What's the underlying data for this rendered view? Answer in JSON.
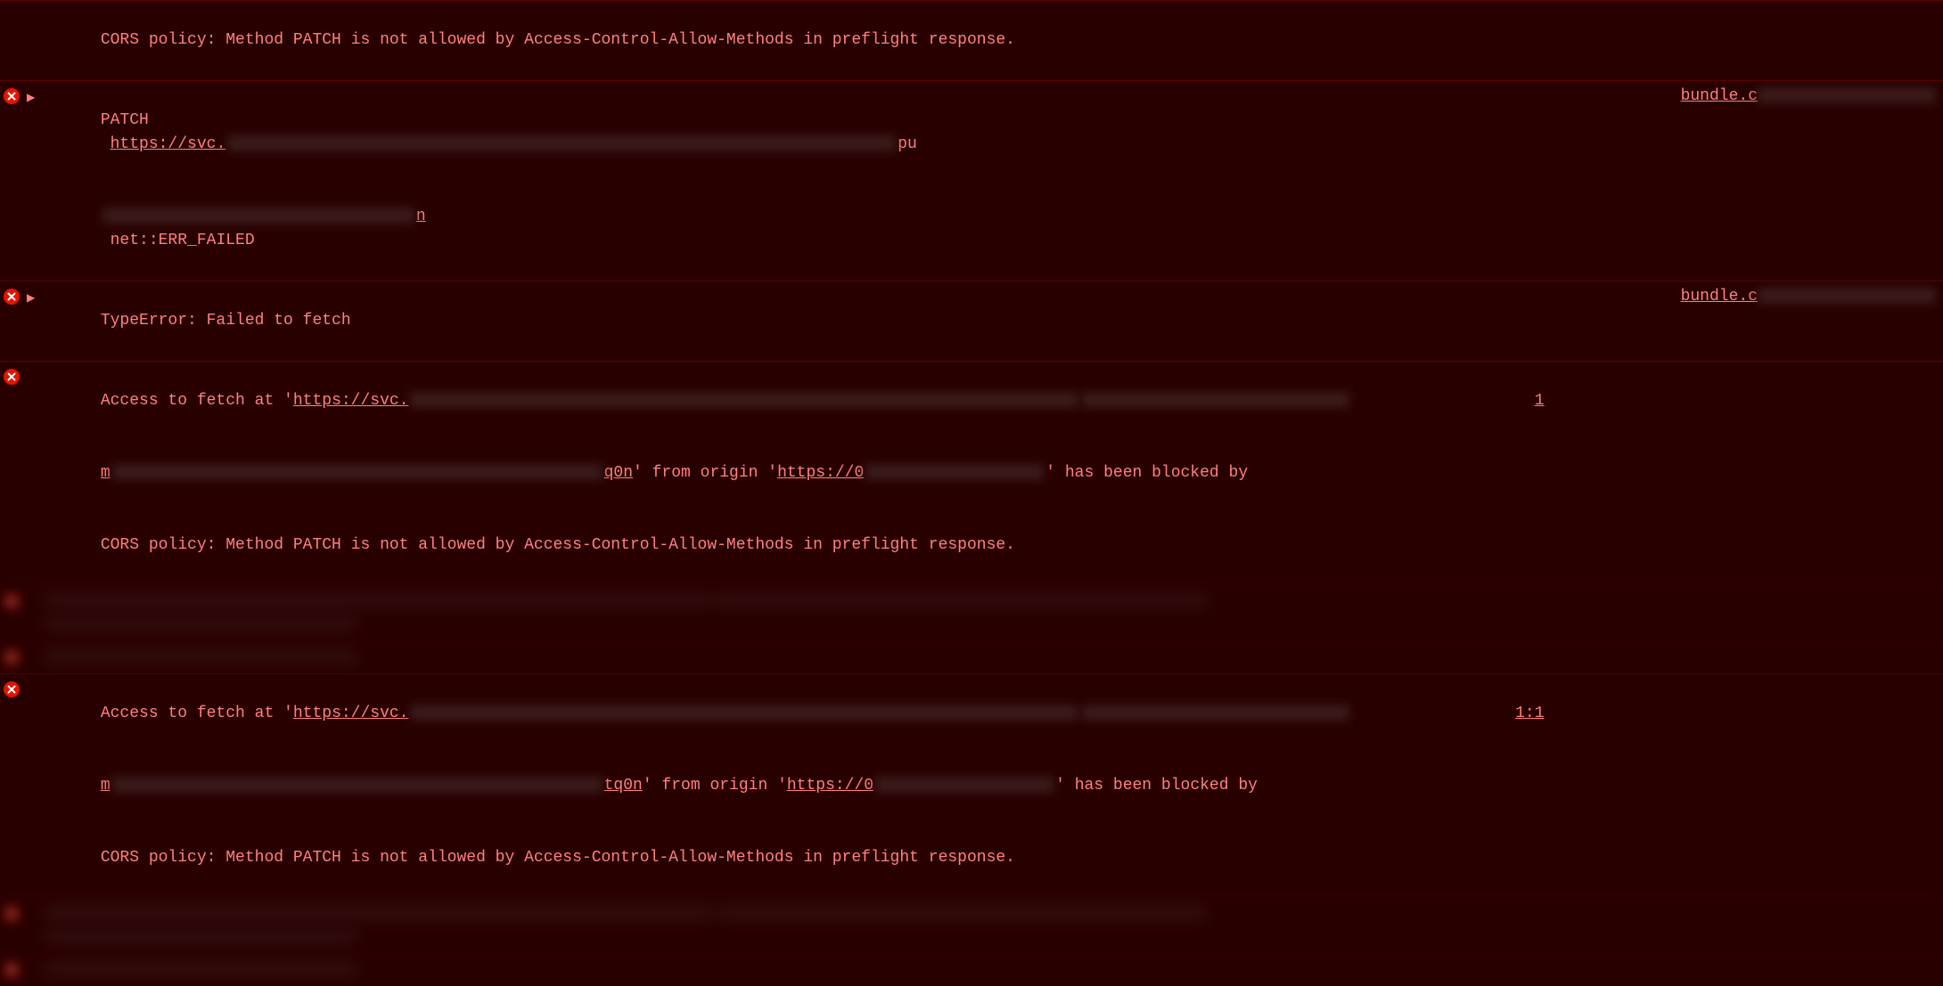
{
  "rows": [
    {
      "type": "error-continuation",
      "disclosure": false,
      "msg": "CORS policy: Method PATCH is not allowed by Access-Control-Allow-Methods in preflight response."
    },
    {
      "type": "error",
      "disclosure": true,
      "method": "PATCH",
      "url_prefix": "https://svc.",
      "after_redact": "pu",
      "line2_suffix": "n",
      "net_err": "net::ERR_FAILED",
      "src": "bundle.c",
      "src_redacted": true
    },
    {
      "type": "error",
      "disclosure": true,
      "msg": "TypeError: Failed to fetch",
      "src": "bundle.c",
      "src_redacted": true
    },
    {
      "type": "error",
      "disclosure": false,
      "prefix": "Access to fetch at '",
      "url_prefix": "https://svc.",
      "mid_frag": "q0n",
      "origin_label": "' from origin '",
      "origin_url": "https://0",
      "blocked_suffix": "' has been blocked by",
      "cors_line": "CORS policy: Method PATCH is not allowed by Access-Control-Allow-Methods in preflight response.",
      "line_num": "1",
      "line2_frag": "m"
    },
    {
      "type": "blurred"
    },
    {
      "type": "blurred"
    },
    {
      "type": "error",
      "disclosure": false,
      "prefix": "Access to fetch at '",
      "url_prefix": "https://svc.",
      "mid_frag": "tq0n",
      "origin_label": "' from origin '",
      "origin_url": "https://0",
      "blocked_suffix": "' has been blocked by",
      "cors_line": "CORS policy: Method PATCH is not allowed by Access-Control-Allow-Methods in preflight response.",
      "line_num": "1:1",
      "line2_frag": "m"
    },
    {
      "type": "blurred"
    },
    {
      "type": "blurred"
    }
  ],
  "labels": {
    "triangle": "▶"
  }
}
